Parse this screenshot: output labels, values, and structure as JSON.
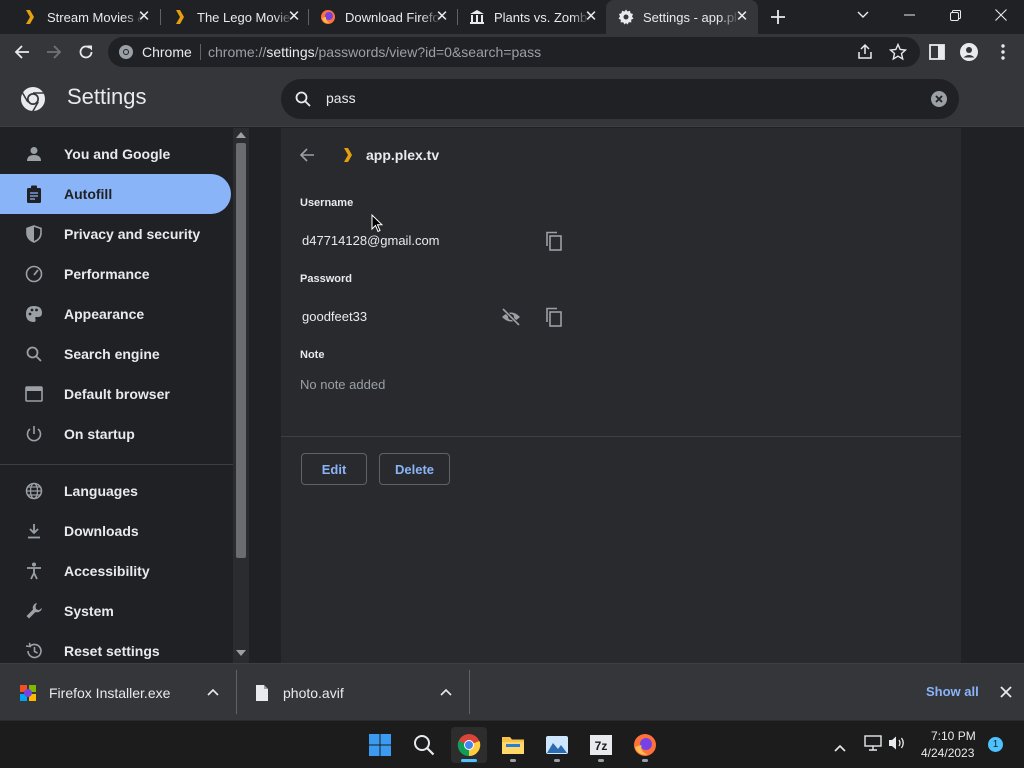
{
  "tabs": [
    {
      "title": "Stream Movies & TV",
      "favicon": "plex-chevron-icon"
    },
    {
      "title": "The Lego Movie",
      "favicon": "plex-chevron-icon"
    },
    {
      "title": "Download Firefox",
      "favicon": "firefox-icon"
    },
    {
      "title": "Plants vs. Zombies",
      "favicon": "museum-icon"
    },
    {
      "title": "Settings - app.plex.tv",
      "favicon": "gear-icon"
    }
  ],
  "omnibox": {
    "site_label": "Chrome",
    "url_prefix": "chrome://",
    "url_host": "settings",
    "url_path": "/passwords/view?id=0&search=pass"
  },
  "settings": {
    "title": "Settings",
    "search_value": "pass"
  },
  "sidebar": {
    "items": [
      {
        "label": "You and Google",
        "icon": "person-icon"
      },
      {
        "label": "Autofill",
        "icon": "clipboard-icon"
      },
      {
        "label": "Privacy and security",
        "icon": "shield-icon"
      },
      {
        "label": "Performance",
        "icon": "speedometer-icon"
      },
      {
        "label": "Appearance",
        "icon": "palette-icon"
      },
      {
        "label": "Search engine",
        "icon": "search-icon"
      },
      {
        "label": "Default browser",
        "icon": "browser-icon"
      },
      {
        "label": "On startup",
        "icon": "power-icon"
      },
      {
        "label": "Languages",
        "icon": "globe-icon"
      },
      {
        "label": "Downloads",
        "icon": "download-icon"
      },
      {
        "label": "Accessibility",
        "icon": "accessibility-icon"
      },
      {
        "label": "System",
        "icon": "wrench-icon"
      },
      {
        "label": "Reset settings",
        "icon": "history-icon"
      }
    ],
    "active": "Autofill"
  },
  "password_entry": {
    "site": "app.plex.tv",
    "username_label": "Username",
    "username": "d47714128@gmail.com",
    "password_label": "Password",
    "password": "goodfeet33",
    "note_label": "Note",
    "note": "No note added",
    "edit_label": "Edit",
    "delete_label": "Delete"
  },
  "downloads": {
    "items": [
      {
        "name": "Firefox Installer.exe"
      },
      {
        "name": "photo.avif"
      }
    ],
    "show_all": "Show all"
  },
  "taskbar": {
    "time": "7:10 PM",
    "date": "4/24/2023",
    "notification_count": "1"
  },
  "colors": {
    "accent": "#8ab4f8",
    "background": "#202124",
    "plex": "#e5a00d"
  }
}
